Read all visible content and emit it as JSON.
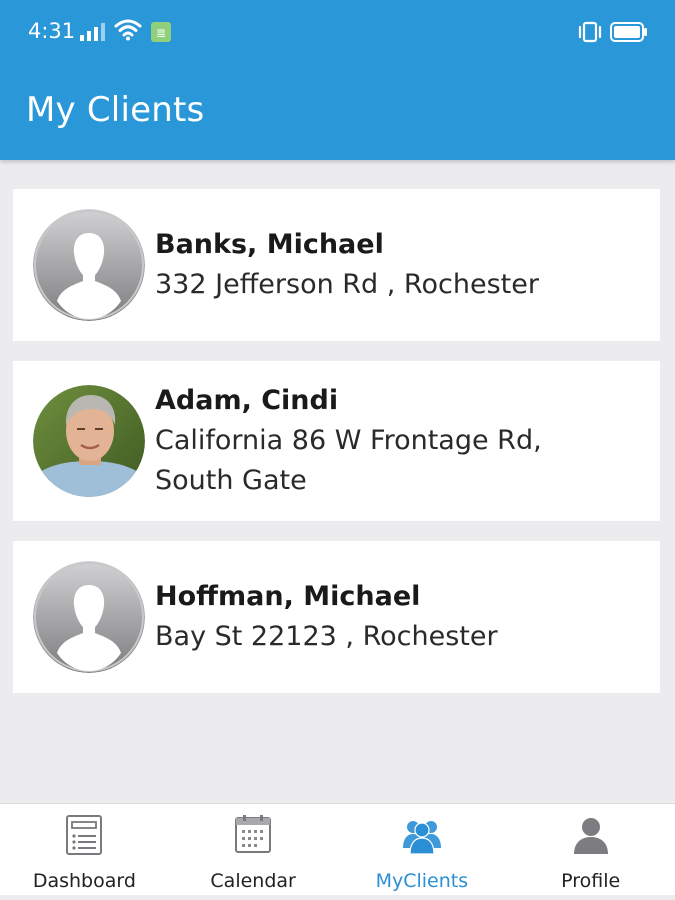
{
  "status_bar": {
    "time": "4:31",
    "icons": [
      "signal-icon",
      "wifi-icon",
      "sim-icon",
      "vibrate-icon",
      "battery-icon"
    ]
  },
  "header": {
    "title": "My Clients",
    "background_color": "#2a97d8"
  },
  "clients": [
    {
      "name": "Banks, Michael",
      "address": "332 Jefferson Rd , Rochester",
      "avatar": "default-avatar-icon"
    },
    {
      "name": "Adam, Cindi",
      "address": "California 86 W Frontage Rd,\nSouth Gate",
      "avatar": "user-photo"
    },
    {
      "name": "Hoffman, Michael",
      "address": "Bay St 22123 , Rochester",
      "avatar": "default-avatar-icon"
    }
  ],
  "bottom_nav": {
    "items": [
      {
        "label": "Dashboard",
        "icon": "dashboard-icon",
        "active": false
      },
      {
        "label": "Calendar",
        "icon": "calendar-icon",
        "active": false
      },
      {
        "label": "MyClients",
        "icon": "clients-icon",
        "active": true
      },
      {
        "label": "Profile",
        "icon": "profile-icon",
        "active": false
      }
    ],
    "active_color": "#2a8fd4"
  }
}
